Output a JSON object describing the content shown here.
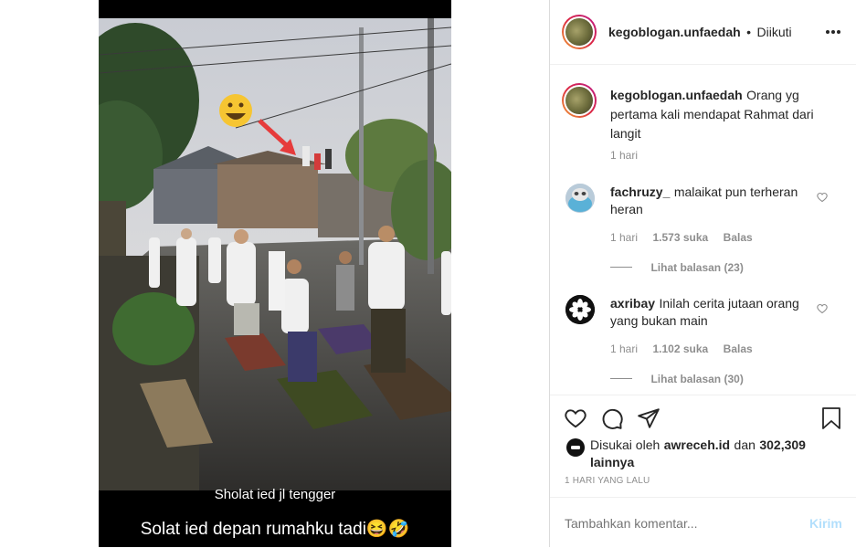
{
  "post": {
    "caption_line1": "Sholat ied jl tengger",
    "caption_line2": "Solat ied depan rumahku tadi😆🤣"
  },
  "header": {
    "username": "kegoblogan.unfaedah",
    "separator": "•",
    "follow_status": "Diikuti",
    "more_icon": "more-horizontal-icon"
  },
  "op_comment": {
    "username": "kegoblogan.unfaedah",
    "text": "Orang yg pertama kali mendapat Rahmat dari langit",
    "time": "1 hari"
  },
  "comments": [
    {
      "username": "fachruzy_",
      "text": "malaikat pun terheran heran",
      "time": "1 hari",
      "likes": "1.573 suka",
      "reply_label": "Balas",
      "view_replies": "Lihat balasan (23)"
    },
    {
      "username": "axribay",
      "text": "Inilah cerita jutaan orang yang bukan main",
      "time": "1 hari",
      "likes": "1.102 suka",
      "reply_label": "Balas",
      "view_replies": "Lihat balasan (30)"
    }
  ],
  "likes": {
    "prefix": "Disukai oleh",
    "user": "awreceh.id",
    "and": "dan",
    "count": "302,309 lainnya"
  },
  "timestamp": "1 HARI YANG LALU",
  "comment_input": {
    "placeholder": "Tambahkan komentar...",
    "submit_label": "Kirim"
  },
  "colors": {
    "text": "#262626",
    "muted": "#8e8e8e",
    "submit_disabled": "#b2dffc",
    "border": "#dbdbdb"
  }
}
